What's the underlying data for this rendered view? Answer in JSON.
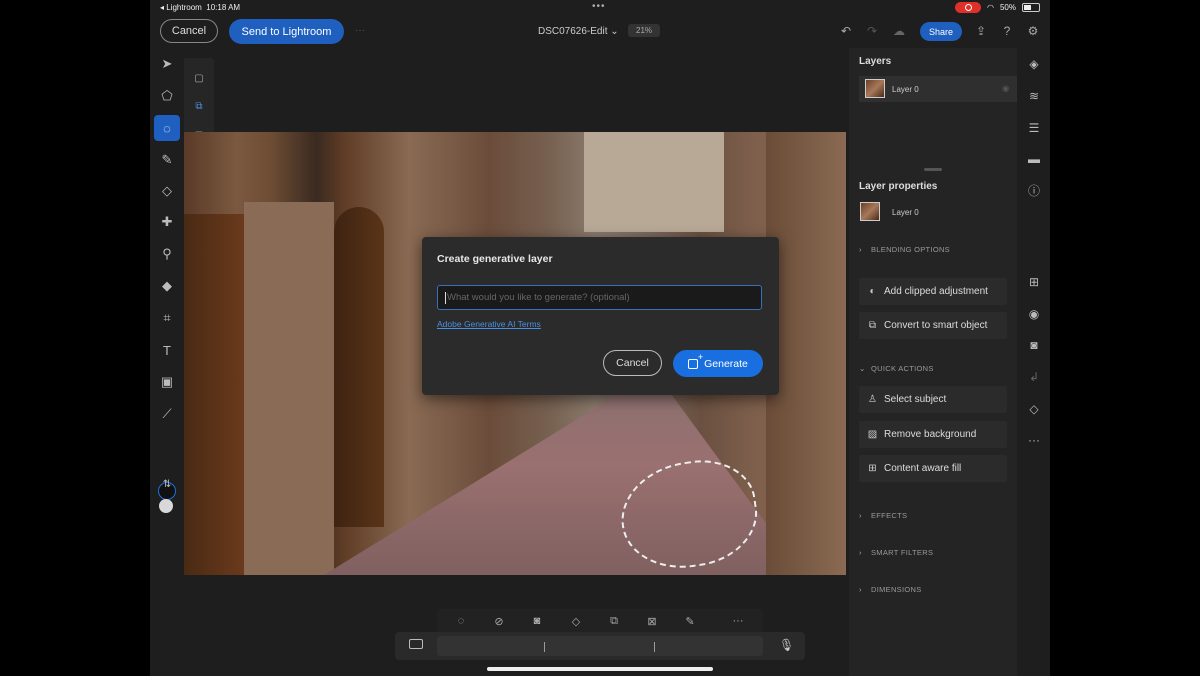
{
  "status_bar": {
    "back_app": "◂ Lightroom",
    "time": "10:18 AM",
    "battery": "50%"
  },
  "topbar": {
    "cancel_label": "Cancel",
    "send_label": "Send to Lightroom",
    "doc_name": "DSC07626-Edit",
    "zoom": "21%",
    "share_label": "Share"
  },
  "dialog": {
    "title": "Create generative layer",
    "input_placeholder": "What would you like to generate? (optional)",
    "input_value": "",
    "terms_link": "Adobe Generative AI Terms",
    "cancel_label": "Cancel",
    "generate_label": "Generate"
  },
  "layers_panel": {
    "title": "Layers",
    "layers": [
      {
        "name": "Layer 0"
      }
    ],
    "properties_title": "Layer properties",
    "properties_layer": "Layer 0",
    "blending": "BLENDING OPTIONS",
    "add_clipped": "Add clipped adjustment",
    "convert_smart": "Convert to smart object",
    "quick_actions": "QUICK ACTIONS",
    "select_subject": "Select subject",
    "remove_background": "Remove background",
    "content_aware_fill": "Content aware fill",
    "effects": "EFFECTS",
    "smart_filters": "SMART FILTERS",
    "dimensions": "DIMENSIONS"
  },
  "colors": {
    "accent": "#1f5fbf",
    "generate": "#1a6fe0",
    "foreground": "#111111",
    "background": "#d8d8d8"
  }
}
